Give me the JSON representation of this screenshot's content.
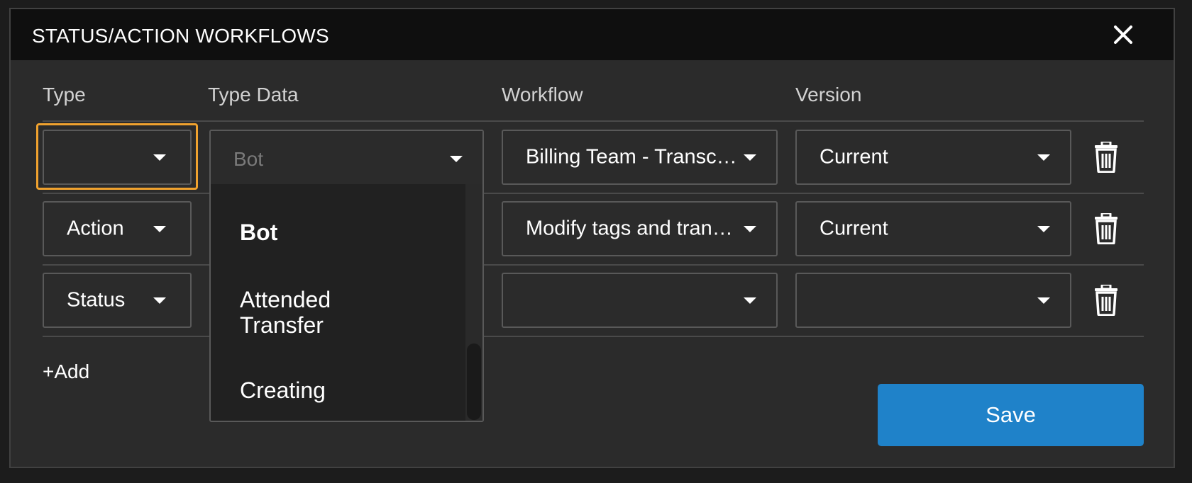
{
  "dialog": {
    "title": "STATUS/ACTION WORKFLOWS",
    "close_icon": "close-icon"
  },
  "columns": {
    "type": "Type",
    "type_data": "Type Data",
    "workflow": "Workflow",
    "version": "Version"
  },
  "rows": [
    {
      "type": "",
      "type_data": "Bot",
      "workflow": "Billing Team - Transc…",
      "version": "Current"
    },
    {
      "type": "Action",
      "type_data": "",
      "workflow": "Modify tags and tran…",
      "version": "Current"
    },
    {
      "type": "Status",
      "type_data": "",
      "workflow": "",
      "version": ""
    }
  ],
  "dropdown": {
    "selected": "Bot",
    "options": [
      "Bot",
      "Attended Transfer",
      "Creating"
    ],
    "option_lines": [
      [
        "Bot"
      ],
      [
        "Attended",
        "Transfer"
      ],
      [
        "Creating"
      ]
    ]
  },
  "actions": {
    "add_label": "+Add",
    "save_label": "Save"
  },
  "colors": {
    "accent": "#1f82c9",
    "focus": "#f0a22e",
    "background": "#2b2b2b",
    "titlebar": "#0f0f0f"
  }
}
